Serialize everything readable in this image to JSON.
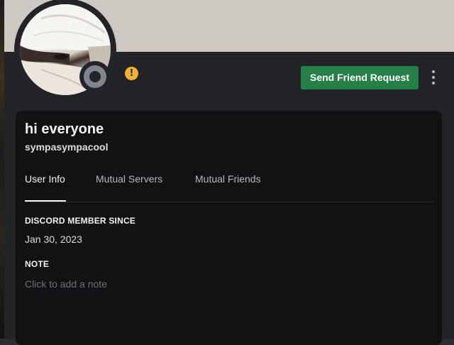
{
  "profile": {
    "display_name": "hi everyone",
    "username": "sympasympacool",
    "status": "offline",
    "status_color": "#80848e",
    "warning_icon": "exclamation-circle-icon",
    "warning_color": "#f0b232",
    "banner_color": "#cdc9c2"
  },
  "actions": {
    "friend_request_label": "Send Friend Request",
    "friend_request_color": "#248046",
    "more_icon": "vertical-ellipsis-icon"
  },
  "tabs": [
    {
      "label": "User Info",
      "active": true
    },
    {
      "label": "Mutual Servers",
      "active": false
    },
    {
      "label": "Mutual Friends",
      "active": false
    }
  ],
  "user_info": {
    "member_since_heading": "DISCORD MEMBER SINCE",
    "member_since_value": "Jan 30, 2023",
    "note_heading": "NOTE",
    "note_placeholder": "Click to add a note",
    "note_value": ""
  }
}
